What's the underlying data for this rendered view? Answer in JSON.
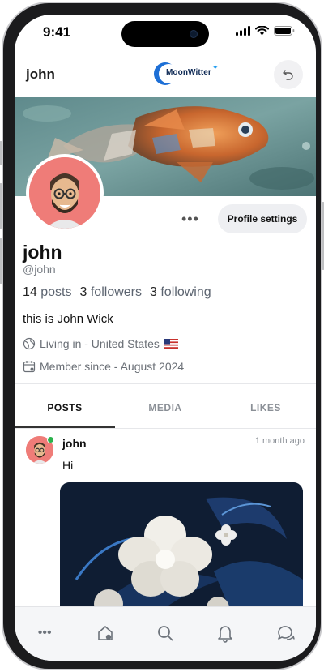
{
  "status_bar": {
    "time": "9:41"
  },
  "header": {
    "username": "john",
    "logo_text": "MoonWitter"
  },
  "profile": {
    "name": "john",
    "handle": "@john",
    "stats": {
      "posts_count": "14",
      "posts_label": "posts",
      "followers_count": "3",
      "followers_label": "followers",
      "following_count": "3",
      "following_label": "following"
    },
    "bio": "this is John Wick",
    "location": "Living in - United States",
    "member_since": "Member since - August 2024",
    "settings_label": "Profile settings",
    "more_label": "•••"
  },
  "tabs": [
    {
      "label": "POSTS",
      "active": true
    },
    {
      "label": "MEDIA",
      "active": false
    },
    {
      "label": "LIKES",
      "active": false
    }
  ],
  "post": {
    "author": "john",
    "time": "1 month ago",
    "text": "Hi"
  },
  "bottom_nav": {
    "items": [
      "more-icon",
      "home-icon",
      "search-icon",
      "bell-icon",
      "chat-icon"
    ],
    "more_label": "•••"
  },
  "colors": {
    "avatar_bg": "#ef7c78",
    "online": "#2bb24c",
    "brand": "#1d6fd6"
  }
}
